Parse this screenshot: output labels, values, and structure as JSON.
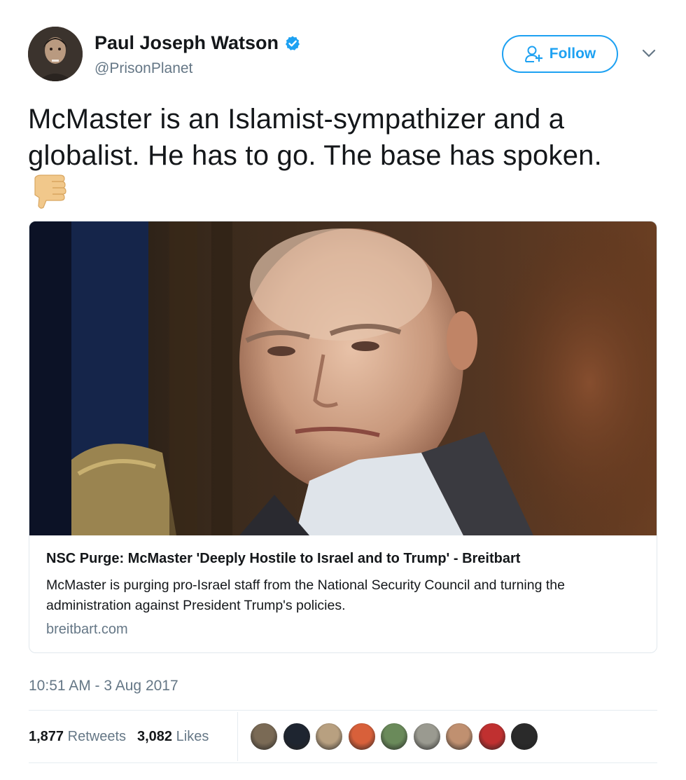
{
  "author": {
    "name": "Paul Joseph Watson",
    "handle": "@PrisonPlanet",
    "verified": true,
    "avatar_icon": "user-avatar"
  },
  "follow_button": {
    "label": "Follow",
    "icon": "add-user-icon"
  },
  "tweet": {
    "text": "McMaster is an Islamist-sympathizer and a globalist. He has to go. The base has spoken.",
    "emoji": "thumbs-down-icon"
  },
  "card": {
    "title": "NSC Purge: McMaster 'Deeply Hostile to Israel and to Trump' - Breitbart",
    "description": "McMaster is purging pro-Israel staff from the National Security Council and turning the administration against President Trump's policies.",
    "domain": "breitbart.com"
  },
  "timestamp": "10:51 AM - 3 Aug 2017",
  "stats": {
    "retweets_count": "1,877",
    "retweets_label": "Retweets",
    "likes_count": "3,082",
    "likes_label": "Likes"
  },
  "colors": {
    "accent": "#1da1f2",
    "text": "#14171a",
    "muted": "#657786",
    "border": "#e1e8ed"
  },
  "likers": [
    {
      "color": "#7a6a55"
    },
    {
      "color": "#1e2530"
    },
    {
      "color": "#b8a080"
    },
    {
      "color": "#d8603a"
    },
    {
      "color": "#6a8a5a"
    },
    {
      "color": "#9a9a90"
    },
    {
      "color": "#c09070"
    },
    {
      "color": "#c03030"
    },
    {
      "color": "#2a2a2a"
    }
  ]
}
